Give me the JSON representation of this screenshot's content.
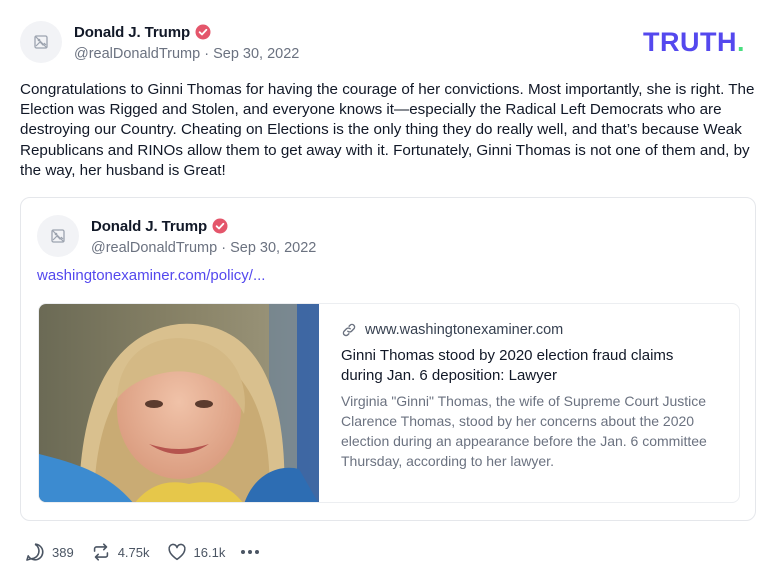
{
  "author": {
    "name": "Donald J. Trump",
    "handle": "@realDonaldTrump",
    "separator": "·",
    "date": "Sep 30, 2022"
  },
  "brand": {
    "logo_text": "TRUTH",
    "logo_dot": "."
  },
  "post": {
    "text": "Congratulations to Ginni Thomas for having the courage of her convictions. Most importantly, she is right. The Election was Rigged and Stolen, and everyone knows it—especially the Radical Left Democrats who are destroying our Country. Cheating on Elections is the only thing they do really well, and that’s because Weak Republicans and RINOs allow them to get away with it. Fortunately, Ginni Thomas is not one of them and, by the way, her husband is Great!"
  },
  "quoted": {
    "name": "Donald J. Trump",
    "handle": "@realDonaldTrump",
    "separator": "·",
    "date": "Sep 30, 2022",
    "link": "washingtonexaminer.com/policy/..."
  },
  "card": {
    "domain": "www.washingtonexaminer.com",
    "title": "Ginni Thomas stood by 2020 election fraud claims during Jan. 6 deposition: Lawyer",
    "description": "Virginia \"Ginni\" Thomas, the wife of Supreme Court Justice Clarence Thomas, stood by her concerns about the 2020 election during an appearance before the Jan. 6 committee Thursday, according to her lawyer."
  },
  "actions": {
    "replies": "389",
    "retruths": "4.75k",
    "likes": "16.1k"
  },
  "icons": {
    "avatar_placeholder": "image-placeholder-icon",
    "verified": "verified-badge-icon",
    "link": "link-icon",
    "reply": "reply-icon",
    "retruth": "retruth-icon",
    "like": "heart-icon",
    "more": "more-icon"
  },
  "colors": {
    "brand": "#5448ee",
    "brand_dot": "#4ade80",
    "verified": "#e4566b",
    "link": "#5448ee",
    "muted": "#6b7280"
  }
}
